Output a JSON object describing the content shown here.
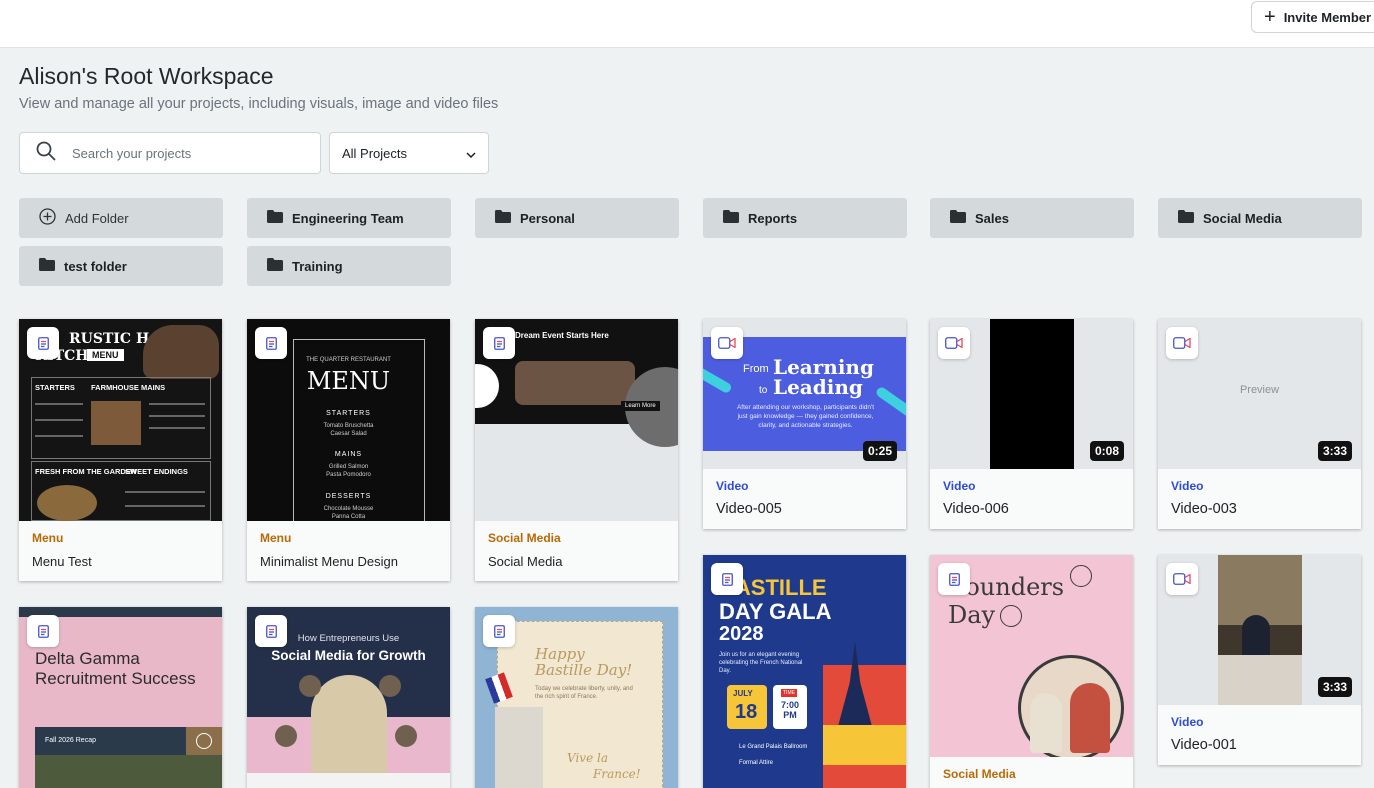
{
  "header": {
    "invite_label": "Invite Member"
  },
  "page": {
    "title": "Alison's Root Workspace",
    "subtitle": "View and manage all your projects, including visuals, image and video files"
  },
  "filters": {
    "search_placeholder": "Search your projects",
    "project_filter": "All Projects"
  },
  "folders": {
    "add_label": "Add Folder",
    "items": [
      "Engineering Team",
      "Personal",
      "Reports",
      "Sales",
      "Social Media",
      "test folder",
      "Training"
    ]
  },
  "projects": [
    {
      "category": "Menu",
      "name": "Menu Test",
      "type": "design",
      "thumb": {
        "line1": "RUSTIC HARVEST",
        "line2": "KITCHEN",
        "tag": "MENU",
        "s1": "STARTERS",
        "s2": "FARMHOUSE MAINS",
        "s3": "FRESH FROM THE GARDEN",
        "s4": "SWEET ENDINGS"
      }
    },
    {
      "category": "Menu",
      "name": "Minimalist Menu Design",
      "type": "design",
      "thumb": {
        "eyebrow": "THE QUARTER RESTAURANT",
        "title": "MENU",
        "sec1": "STARTERS",
        "items1": "Tomato Bruschetta\nCaesar Salad",
        "sec2": "MAINS",
        "items2": "Grilled Salmon\nPasta Pomodoro",
        "sec3": "DESSERTS",
        "items3": "Chocolate Mousse\nPanna Cotta"
      }
    },
    {
      "category": "Social Media",
      "name": "Social Media",
      "type": "design",
      "thumb": {
        "headline": "Dream Event Starts Here",
        "cta": "Learn More"
      }
    },
    {
      "category": "Video",
      "name": "Video-005",
      "type": "video",
      "duration": "0:25",
      "thumb": {
        "from": "From",
        "learning": "Learning",
        "to": "to",
        "leading": "Leading",
        "body": "After attending our workshop, participants didn't just gain knowledge — they gained confidence, clarity, and actionable strategies."
      }
    },
    {
      "category": "Video",
      "name": "Video-006",
      "type": "video",
      "duration": "0:08"
    },
    {
      "category": "Video",
      "name": "Video-003",
      "type": "video",
      "duration": "3:33",
      "thumb": {
        "label": "Preview"
      }
    },
    {
      "category": "",
      "name": "",
      "type": "design",
      "thumb": {
        "title": "Delta Gamma Recruitment Success",
        "recap": "Fall 2026 Recap"
      }
    },
    {
      "category": "",
      "name": "",
      "type": "design",
      "thumb": {
        "eyebrow": "How Entrepreneurs Use",
        "title": "Social Media for Growth"
      }
    },
    {
      "category": "",
      "name": "",
      "type": "design",
      "thumb": {
        "title1": "Happy",
        "title2": "Bastille Day!",
        "body": "Today we celebrate liberty, unity, and the rich spirit of France.",
        "sign1": "Vive la",
        "sign2": "France!"
      }
    },
    {
      "category": "",
      "name": "",
      "type": "design",
      "thumb": {
        "title1": "BASTILLE",
        "title2": "DAY GALA",
        "year": "2028",
        "body": "Join us for an elegant evening celebrating the French National Day.",
        "month": "JULY",
        "day": "18",
        "time_label": "TIME",
        "time": "7:00 PM",
        "venue": "Le Grand Palais Ballroom",
        "dress": "Formal Attire"
      }
    },
    {
      "category": "Social Media",
      "name": "",
      "type": "design",
      "thumb": {
        "title1": "Founders",
        "title2": "Day"
      }
    },
    {
      "category": "Video",
      "name": "Video-001",
      "type": "video",
      "duration": "3:33"
    }
  ]
}
